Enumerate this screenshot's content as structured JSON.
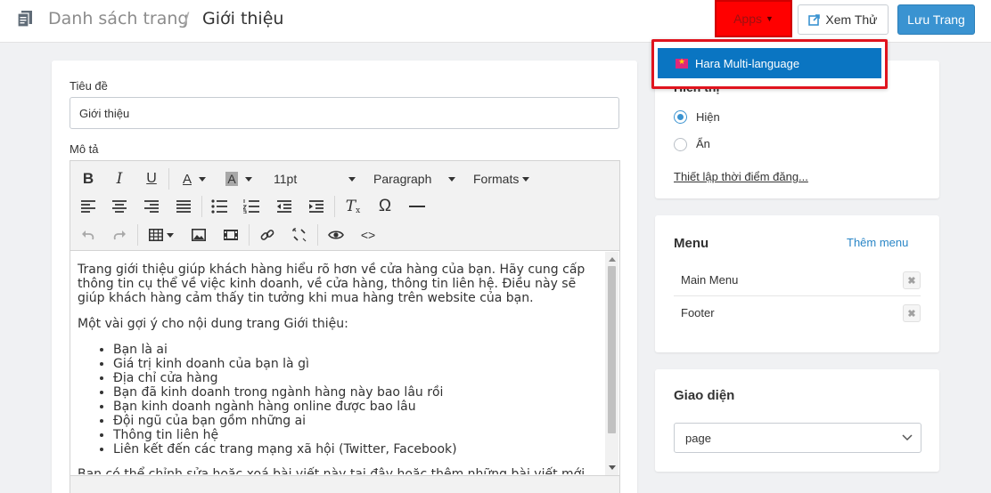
{
  "header": {
    "breadcrumb_parent": "Danh sách trang",
    "breadcrumb_separator": "/",
    "breadcrumb_current": "Giới thiệu",
    "apps_label": "Apps",
    "preview_label": "Xem Thử",
    "save_label": "Lưu Trang"
  },
  "apps_dropdown": {
    "items": [
      {
        "label": "Hara Multi-language",
        "icon": "vietnam-flag-icon"
      }
    ],
    "highlight_color": "#e0141e"
  },
  "form": {
    "title_label": "Tiêu đề",
    "title_value": "Giới thiệu",
    "description_label": "Mô tả"
  },
  "editor": {
    "font_size": "11pt",
    "block_format": "Paragraph",
    "formats_label": "Formats",
    "paragraph_1": "Trang giới thiệu giúp khách hàng hiểu rõ hơn về cửa hàng của bạn. Hãy cung cấp thông tin cụ thể về việc kinh doanh, về cửa hàng, thông tin liên hệ. Điều này sẽ giúp khách hàng cảm thấy tin tưởng khi mua hàng trên website của bạn.",
    "paragraph_2": "Một vài gợi ý cho nội dung trang Giới thiệu:",
    "bullets": [
      "Bạn là ai",
      "Giá trị kinh doanh của bạn là gì",
      "Địa chỉ cửa hàng",
      "Bạn đã kinh doanh trong ngành hàng này bao lâu rồi",
      "Bạn kinh doanh ngành hàng online được bao lâu",
      "Đội ngũ của bạn gồm những ai",
      "Thông tin liên hệ",
      "Liên kết đến các trang mạng xã hội (Twitter, Facebook)"
    ],
    "paragraph_3_partial": "Bạn có thể chỉnh sửa hoặc xoá bài viết này tại đây hoặc thêm những bài viết mới"
  },
  "visibility": {
    "title": "Hiển thị",
    "option_show": "Hiện",
    "option_hide": "Ẩn",
    "selected": "Hiện",
    "schedule_link": "Thiết lập thời điểm đăng..."
  },
  "menu": {
    "title": "Menu",
    "add_label": "Thêm menu",
    "items": [
      "Main Menu",
      "Footer"
    ]
  },
  "theme": {
    "title": "Giao diện",
    "selected": "page"
  },
  "colors": {
    "primary": "#3a93d1",
    "dropdown_active": "#0a75c2",
    "apps_button": "#ff0000"
  }
}
